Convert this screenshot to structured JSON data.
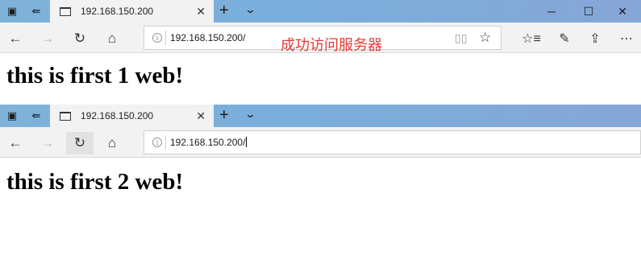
{
  "window1": {
    "tab_title": "192.168.150.200",
    "address": "192.168.150.200/",
    "overlay": "成功访问服务器",
    "page_heading": "this is first 1 web!"
  },
  "window2": {
    "tab_title": "192.168.150.200",
    "address": "192.168.150.200/",
    "page_heading": "this is first 2 web!"
  },
  "glyphs": {
    "tab_close": "✕",
    "new_tab": "+",
    "tab_list": "⌄",
    "minimize": "─",
    "maximize": "☐",
    "close": "✕",
    "back": "←",
    "forward": "→",
    "refresh": "↻",
    "home": "⌂",
    "reading": "📖",
    "favorite": "☆",
    "favorites": "☆",
    "notes": "✎",
    "share": "⇪",
    "more": "⋯"
  }
}
